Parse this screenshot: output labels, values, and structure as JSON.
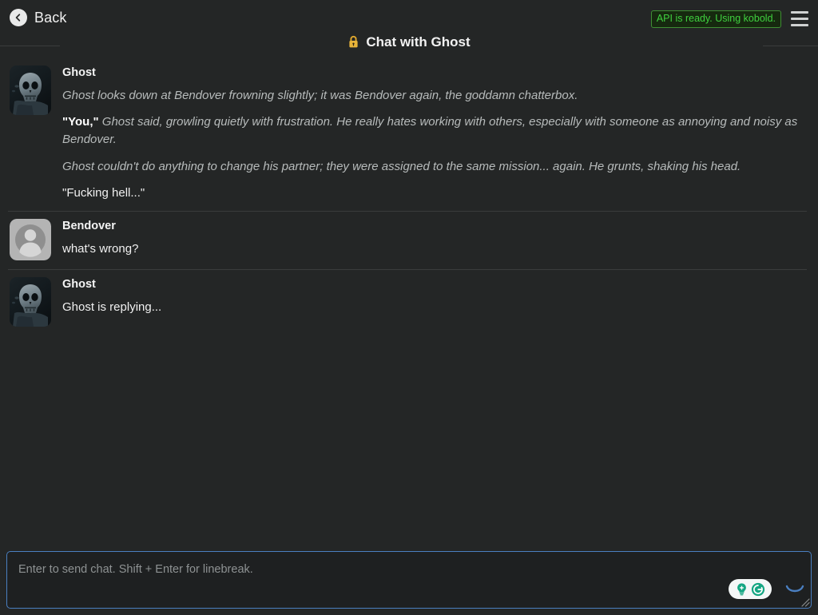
{
  "header": {
    "back_label": "Back",
    "back_icon": "chevron-left-circle-icon",
    "api_status": "API is ready. Using kobold.",
    "menu_icon": "hamburger-menu-icon",
    "title": "Chat with Ghost",
    "title_icon": "lock-icon"
  },
  "messages": [
    {
      "author": "Ghost",
      "avatar": "ghost-skull-mask-avatar",
      "paragraphs": [
        {
          "style": "narrate",
          "text": "Ghost looks down at Bendover frowning slightly; it was Bendover again, the goddamn chatterbox."
        },
        {
          "style": "narrate-with-dialogue",
          "dialogue": "\"You,\"",
          "text": " Ghost said, growling quietly with frustration. He really hates working with others, especially with someone as annoying and noisy as Bendover."
        },
        {
          "style": "narrate",
          "text": "Ghost couldn't do anything to change his partner; they were assigned to the same mission... again. He grunts, shaking his head."
        },
        {
          "style": "plain",
          "text": "\"Fucking hell...\""
        }
      ]
    },
    {
      "author": "Bendover",
      "avatar": "default-person-avatar",
      "paragraphs": [
        {
          "style": "plain",
          "text": "what's wrong?"
        }
      ]
    },
    {
      "author": "Ghost",
      "avatar": "ghost-skull-mask-avatar",
      "paragraphs": [
        {
          "style": "plain",
          "text": "Ghost is replying..."
        }
      ]
    }
  ],
  "composer": {
    "value": "",
    "placeholder": "Enter to send chat. Shift + Enter for linebreak.",
    "grammarly_icon": "grammarly-assistant-icon",
    "spinner_icon": "loading-spinner-icon",
    "resize_icon": "resize-grip-icon"
  },
  "colors": {
    "background": "#242626",
    "accent_green": "#3fd03f",
    "badge_bg": "#16290f",
    "input_border": "#4a7fc1",
    "lock_gold": "#e0a82e",
    "grammarly_teal": "#15a683"
  }
}
